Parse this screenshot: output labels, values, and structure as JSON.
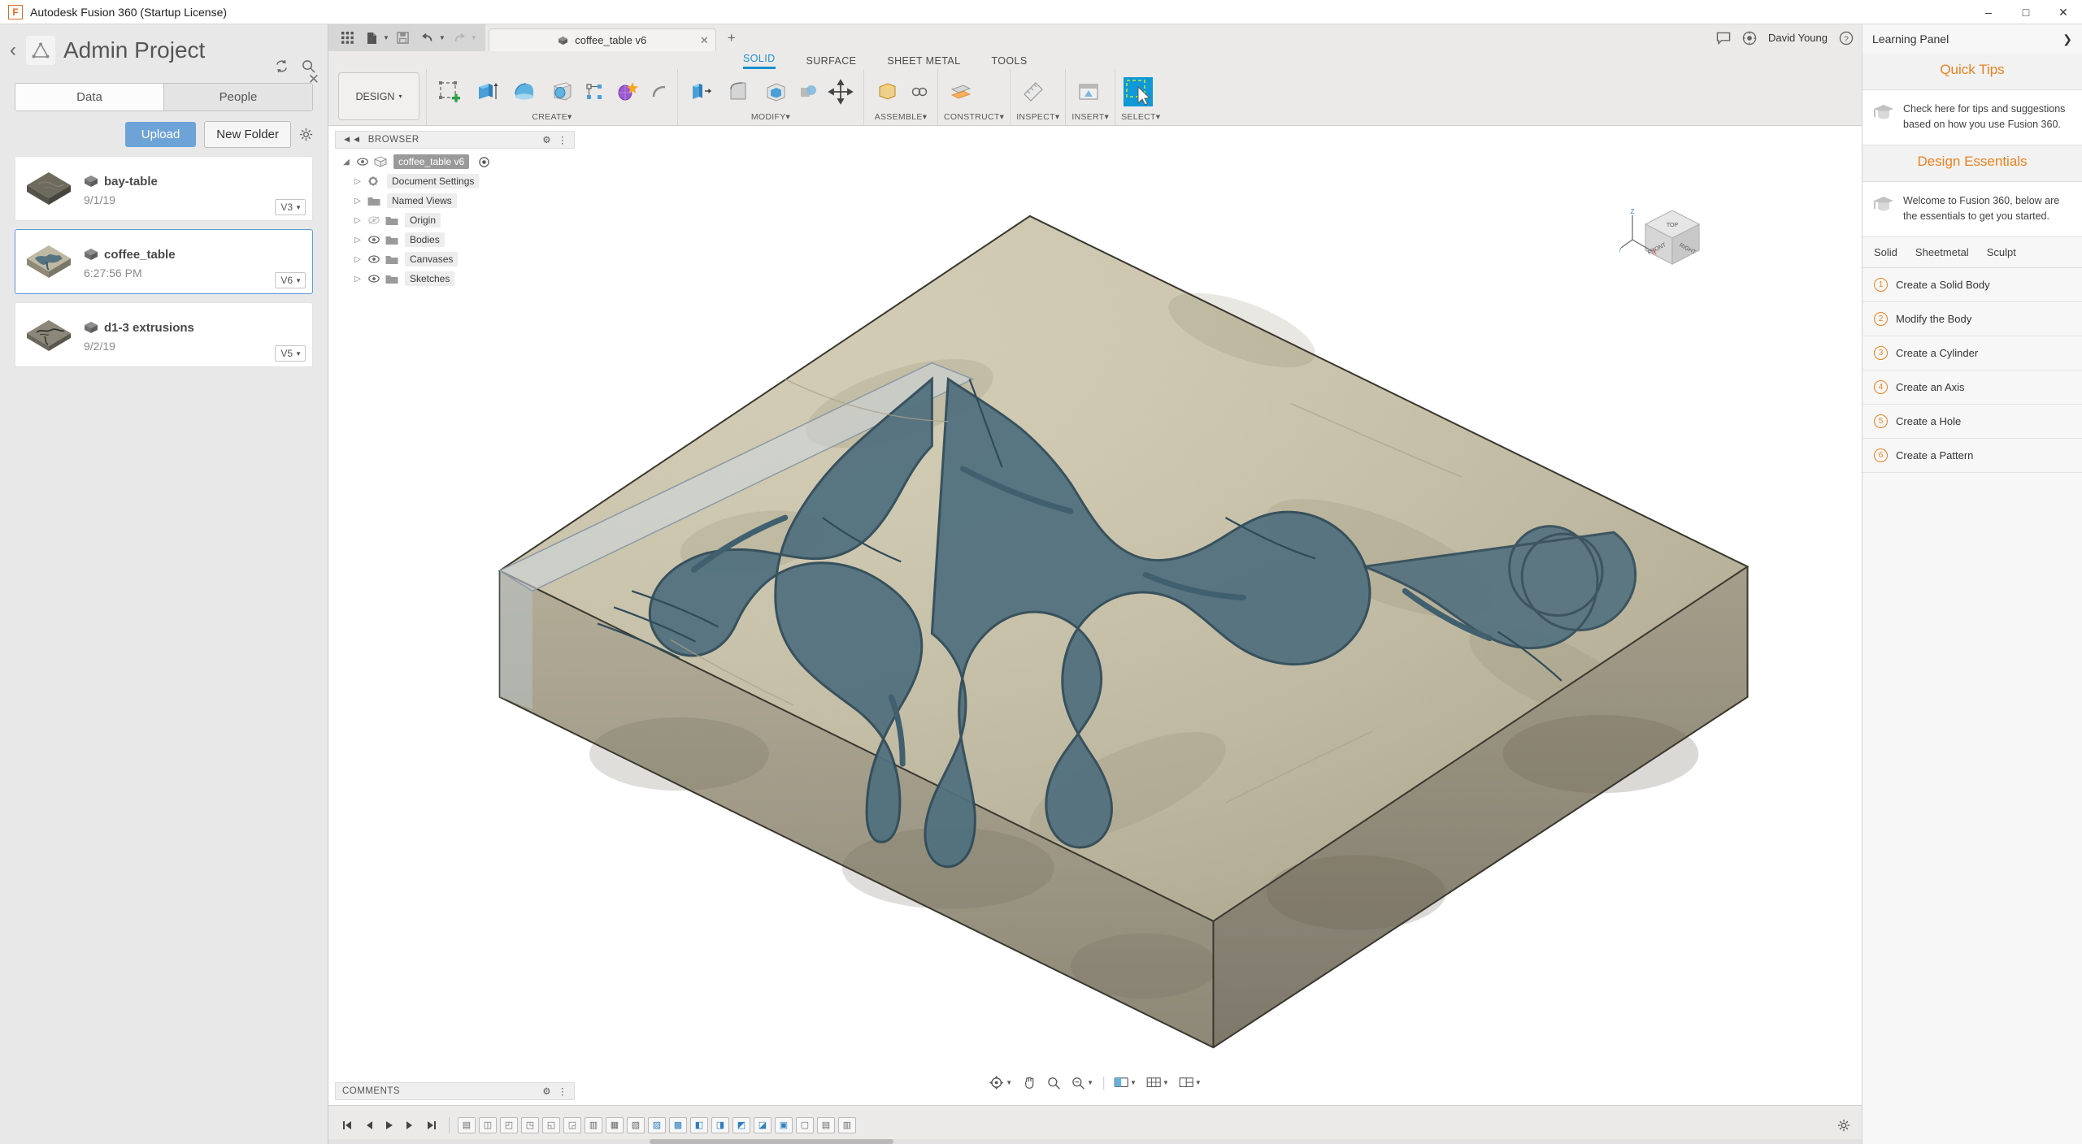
{
  "window": {
    "title": "Autodesk Fusion 360 (Startup License)",
    "minimize": "–",
    "maximize": "□",
    "close": "✕"
  },
  "data_panel": {
    "back_icon": "‹",
    "project_title": "Admin Project",
    "logo_icon": "fusion-triangle-icon",
    "refresh_icon": "refresh-icon",
    "search_icon": "search-icon",
    "close_icon": "✕",
    "tabs": [
      {
        "label": "Data",
        "active": true
      },
      {
        "label": "People",
        "active": false
      }
    ],
    "upload_label": "Upload",
    "new_folder_label": "New Folder",
    "settings_icon": "gear-icon",
    "files": [
      {
        "name": "bay-table",
        "date": "9/1/19",
        "version": "V3",
        "selected": false
      },
      {
        "name": "coffee_table",
        "date": "6:27:56 PM",
        "version": "V6",
        "selected": true
      },
      {
        "name": "d1-3 extrusions",
        "date": "9/2/19",
        "version": "V5",
        "selected": false
      }
    ]
  },
  "quick_access": {
    "grid_icon": "app-grid-icon",
    "file_icon": "file-icon",
    "save_icon": "save-icon",
    "undo_icon": "undo-icon",
    "redo_icon": "redo-icon"
  },
  "document_tab": {
    "label": "coffee_table v6",
    "cube_icon": "cube-icon",
    "close_icon": "✕",
    "add_tab_icon": "+"
  },
  "top_right": {
    "comment_icon": "comment-icon",
    "notify_icon": "bell-icon",
    "help_icon": "?",
    "user_name": "David Young"
  },
  "ribbon": {
    "tabs": [
      {
        "label": "SOLID",
        "active": true
      },
      {
        "label": "SURFACE",
        "active": false
      },
      {
        "label": "SHEET METAL",
        "active": false
      },
      {
        "label": "TOOLS",
        "active": false
      }
    ],
    "workspace_label": "DESIGN",
    "workspace_caret": "▾",
    "panels": [
      {
        "label": "CREATE",
        "caret": "▾",
        "tools": [
          "create-sketch-icon",
          "extrude-icon",
          "revolve-icon",
          "hole-icon",
          "thread-icon",
          "pattern-icon",
          "pipe-icon"
        ]
      },
      {
        "label": "MODIFY",
        "caret": "▾",
        "tools": [
          "press-pull-icon",
          "fillet-icon",
          "shell-icon",
          "combine-icon",
          "move-copy-icon"
        ]
      },
      {
        "label": "ASSEMBLE",
        "caret": "▾",
        "tools": [
          "new-component-icon",
          "joint-icon"
        ]
      },
      {
        "label": "CONSTRUCT",
        "caret": "▾",
        "tools": [
          "offset-plane-icon"
        ]
      },
      {
        "label": "INSPECT",
        "caret": "▾",
        "tools": [
          "measure-icon"
        ]
      },
      {
        "label": "INSERT",
        "caret": "▾",
        "tools": [
          "insert-mcmaster-icon"
        ]
      },
      {
        "label": "SELECT",
        "caret": "▾",
        "tools": [
          "select-window-icon"
        ],
        "selected": true
      }
    ]
  },
  "browser": {
    "header_label": "BROWSER",
    "collapse_icon": "◄◄",
    "settings_icon": "⚙",
    "tree": [
      {
        "label": "coffee_table v6",
        "root": true,
        "eye": true,
        "indent": 0
      },
      {
        "label": "Document Settings",
        "root": false,
        "eye": false,
        "indent": 1,
        "icon": "gear-icon"
      },
      {
        "label": "Named Views",
        "root": false,
        "eye": false,
        "indent": 1,
        "icon": "folder-icon"
      },
      {
        "label": "Origin",
        "root": false,
        "eye": true,
        "hidden": true,
        "indent": 1,
        "icon": "folder-icon"
      },
      {
        "label": "Bodies",
        "root": false,
        "eye": true,
        "indent": 1,
        "icon": "folder-icon"
      },
      {
        "label": "Canvases",
        "root": false,
        "eye": true,
        "indent": 1,
        "icon": "folder-icon"
      },
      {
        "label": "Sketches",
        "root": false,
        "eye": true,
        "indent": 1,
        "icon": "folder-icon"
      }
    ]
  },
  "viewcube": {
    "top_label": "TOP",
    "front_label": "FRONT",
    "right_label": "RIGHT",
    "axis_z": "Z",
    "axis_x": "X",
    "axis_y": "Y"
  },
  "comments": {
    "label": "COMMENTS",
    "settings_icon": "⚙"
  },
  "nav_bar": {
    "items": [
      "orbit-icon",
      "pan-icon",
      "zoom-icon",
      "zoom-window-icon",
      "display-settings-icon",
      "grid-snap-icon",
      "viewports-icon"
    ]
  },
  "timeline": {
    "controls": [
      "go-to-start",
      "step-back",
      "play",
      "step-forward",
      "go-to-end"
    ],
    "feature_count": 19,
    "settings_icon": "gear-icon"
  },
  "learning_panel": {
    "title": "Learning Panel",
    "collapse_icon": "❯",
    "sections": [
      {
        "title": "Quick Tips",
        "tip": "Check here for tips and suggestions based on how you use Fusion 360.",
        "icon": "graduation-cap-icon"
      },
      {
        "title": "Design Essentials",
        "tip": "Welcome to Fusion 360, below are the essentials to get you started.",
        "icon": "graduation-cap-icon"
      }
    ],
    "subtabs": [
      {
        "label": "Solid",
        "active": true
      },
      {
        "label": "Sheetmetal",
        "active": false
      },
      {
        "label": "Sculpt",
        "active": false
      }
    ],
    "items": [
      {
        "num": "1",
        "label": "Create a Solid Body"
      },
      {
        "num": "2",
        "label": "Modify the Body"
      },
      {
        "num": "3",
        "label": "Create a Cylinder"
      },
      {
        "num": "4",
        "label": "Create an Axis"
      },
      {
        "num": "5",
        "label": "Create a Hole"
      },
      {
        "num": "6",
        "label": "Create a Pattern"
      }
    ]
  },
  "colors": {
    "accent_blue": "#1a8fd1",
    "orange": "#e8821e",
    "upload_blue": "#6ea3d8",
    "model_top": "#cfc8ae",
    "model_water": "#4a6b7c",
    "model_side": "#9c9684"
  }
}
